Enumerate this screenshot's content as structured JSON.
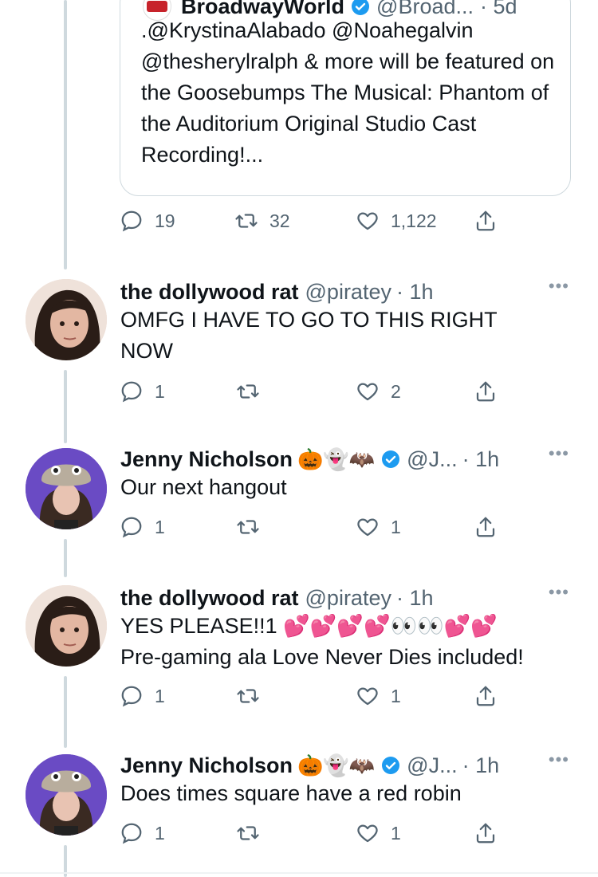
{
  "quoted_tweet": {
    "name": "BroadwayWorld",
    "handle": "@Broad...",
    "time": "· 5d",
    "text": ".@KrystinaAlabado @Noahegalvin @thesherylralph & more will be featured on the Goosebumps The Musical: Phantom of the Auditorium Original Studio Cast Recording!...",
    "actions": {
      "replies": "19",
      "retweets": "32",
      "likes": "1,122"
    }
  },
  "tweets": [
    {
      "name": "the dollywood rat",
      "handle": "@piratey",
      "time": "· 1h",
      "text": "OMFG I HAVE TO GO TO THIS RIGHT NOW",
      "replies": "1",
      "retweets": "",
      "likes": "2",
      "avatar": "dark-haired-woman-avatar"
    },
    {
      "name": "Jenny Nicholson",
      "name_emojis": "🎃👻🦇",
      "handle": "@J...",
      "time": "· 1h",
      "text": "Our next hangout",
      "replies": "1",
      "retweets": "",
      "likes": "1",
      "avatar": "plush-hat-avatar"
    },
    {
      "name": "the dollywood rat",
      "handle": "@piratey",
      "time": "· 1h",
      "text": "YES PLEASE!!1 💕💕💕💕👀👀💕💕\nPre-gaming ala Love Never Dies included!",
      "text_line1": "YES PLEASE!!1 💕💕💕💕👀👀💕💕",
      "text_line2": "Pre-gaming ala Love Never Dies included!",
      "replies": "1",
      "retweets": "",
      "likes": "1",
      "avatar": "dark-haired-woman-avatar"
    },
    {
      "name": "Jenny Nicholson",
      "name_emojis": "🎃👻🦇",
      "handle": "@J...",
      "time": "· 1h",
      "text": "Does times square have a red robin",
      "replies": "1",
      "retweets": "",
      "likes": "1",
      "avatar": "plush-hat-avatar"
    }
  ],
  "more_label": "•••",
  "colors": {
    "text": "#0f1419",
    "muted": "#536471",
    "verified": "#1d9bf0",
    "line": "#cfd9de"
  }
}
